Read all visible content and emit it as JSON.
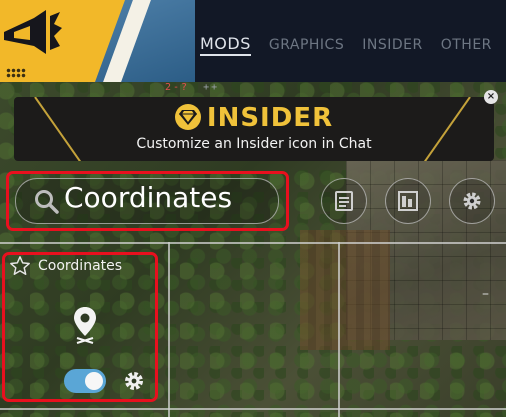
{
  "header": {
    "tabs": [
      {
        "label": "MODS",
        "active": true
      },
      {
        "label": "GRAPHICS",
        "active": false
      },
      {
        "label": "INSIDER",
        "active": false
      },
      {
        "label": "OTHER",
        "active": false
      }
    ],
    "colors": {
      "brand_yellow": "#f2b829",
      "brand_blue": "#2c5d86",
      "header_bg": "#121826"
    }
  },
  "hud": {
    "coords": "2-?",
    "extra": "++"
  },
  "banner": {
    "icon": "diamond-icon",
    "title": "INSIDER",
    "subtitle": "Customize an Insider icon in Chat",
    "close_label": "×"
  },
  "search": {
    "value": "Coordinates",
    "icon": "search-icon"
  },
  "toolbar": {
    "icons": [
      "file-list-icon",
      "columns-icon",
      "gear-icon"
    ]
  },
  "mod_card": {
    "title": "Coordinates",
    "favorite_icon": "star-icon",
    "mod_icon": "map-pin-icon",
    "enabled": true,
    "settings_icon": "gear-icon"
  },
  "highlight_color": "#e8101e",
  "toggle_color": "#5aa6d6"
}
